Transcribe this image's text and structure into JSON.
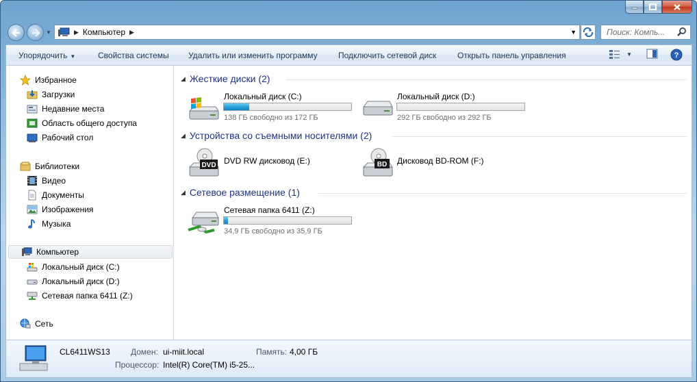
{
  "window": {
    "caption_buttons": [
      "minimize-icon",
      "maximize-icon",
      "close-icon"
    ]
  },
  "address_bar": {
    "crumbs": [
      "Компьютер"
    ],
    "search_placeholder": "Поиск: Компь..."
  },
  "toolbar": {
    "organize_label": "Упорядочить",
    "system_properties_label": "Свойства системы",
    "uninstall_label": "Удалить или изменить программу",
    "map_drive_label": "Подключить сетевой диск",
    "control_panel_label": "Открыть панель управления"
  },
  "sidebar": {
    "favorites": {
      "label": "Избранное",
      "items": [
        {
          "label": "Загрузки",
          "icon": "downloads-folder-icon"
        },
        {
          "label": "Недавние места",
          "icon": "recent-places-icon"
        },
        {
          "label": "Область общего доступа",
          "icon": "public-folder-icon"
        },
        {
          "label": "Рабочий стол",
          "icon": "desktop-icon"
        }
      ]
    },
    "libraries": {
      "label": "Библиотеки",
      "items": [
        {
          "label": "Видео",
          "icon": "video-library-icon"
        },
        {
          "label": "Документы",
          "icon": "documents-library-icon"
        },
        {
          "label": "Изображения",
          "icon": "pictures-library-icon"
        },
        {
          "label": "Музыка",
          "icon": "music-library-icon"
        }
      ]
    },
    "computer": {
      "label": "Компьютер",
      "items": [
        {
          "label": "Локальный диск (C:)",
          "icon": "system-drive-icon"
        },
        {
          "label": "Локальный диск (D:)",
          "icon": "hard-drive-icon"
        },
        {
          "label": "Сетевая папка 6411 (Z:)",
          "icon": "network-drive-icon"
        }
      ]
    },
    "network": {
      "label": "Сеть"
    }
  },
  "groups": {
    "hard_disks": {
      "title": "Жесткие диски (2)",
      "drives": [
        {
          "name": "Локальный диск (C:)",
          "free": "138 ГБ свободно из 172 ГБ",
          "used_fraction": 0.2
        },
        {
          "name": "Локальный диск (D:)",
          "free": "292 ГБ свободно из 292 ГБ",
          "used_fraction": 0.0
        }
      ]
    },
    "removable": {
      "title": "Устройства со съемными носителями (2)",
      "drives": [
        {
          "name": "DVD RW дисковод (E:)",
          "icon_text": "DVD"
        },
        {
          "name": "Дисковод BD-ROM (F:)",
          "icon_text": "BD"
        }
      ]
    },
    "network_locations": {
      "title": "Сетевое размещение (1)",
      "drives": [
        {
          "name": "Сетевая папка 6411 (Z:)",
          "free": "34,9 ГБ свободно из 35,9 ГБ",
          "used_fraction": 0.03
        }
      ]
    }
  },
  "details": {
    "pc_name": "CL6411WS13",
    "domain_label": "Домен:",
    "domain_value": "ui-miit.local",
    "memory_label": "Память:",
    "memory_value": "4,00 ГБ",
    "cpu_label": "Процессор:",
    "cpu_value": "Intel(R) Core(TM) i5-25..."
  },
  "colors": {
    "accent_text": "#1e3287",
    "bar_fill": "#26a0da",
    "frame": "#8ebde0"
  }
}
